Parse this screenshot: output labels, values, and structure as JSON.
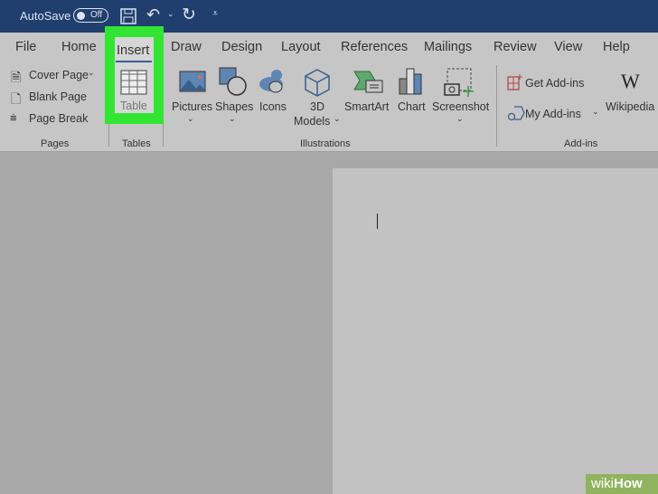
{
  "titlebar": {
    "autosave": "AutoSave",
    "toggle": "Off"
  },
  "tabs": [
    "File",
    "Home",
    "Insert",
    "Draw",
    "Design",
    "Layout",
    "References",
    "Mailings",
    "Review",
    "View",
    "Help"
  ],
  "ribbon": {
    "pages": {
      "items": [
        "Cover Page",
        "Blank Page",
        "Page Break"
      ],
      "label": "Pages"
    },
    "tables": {
      "table": "Table",
      "label": "Tables"
    },
    "illustrations": {
      "pictures": "Pictures",
      "shapes": "Shapes",
      "icons": "Icons",
      "models_1": "3D",
      "models_2": "Models",
      "smartart": "SmartArt",
      "chart": "Chart",
      "screenshot": "Screenshot",
      "label": "Illustrations"
    },
    "addins": {
      "get": "Get Add-ins",
      "my": "My Add-ins",
      "wikipedia": "Wikipedia",
      "label": "Add-ins"
    }
  },
  "highlight_color": "#33e533",
  "watermark": {
    "wiki": "wiki",
    "how": "How"
  }
}
